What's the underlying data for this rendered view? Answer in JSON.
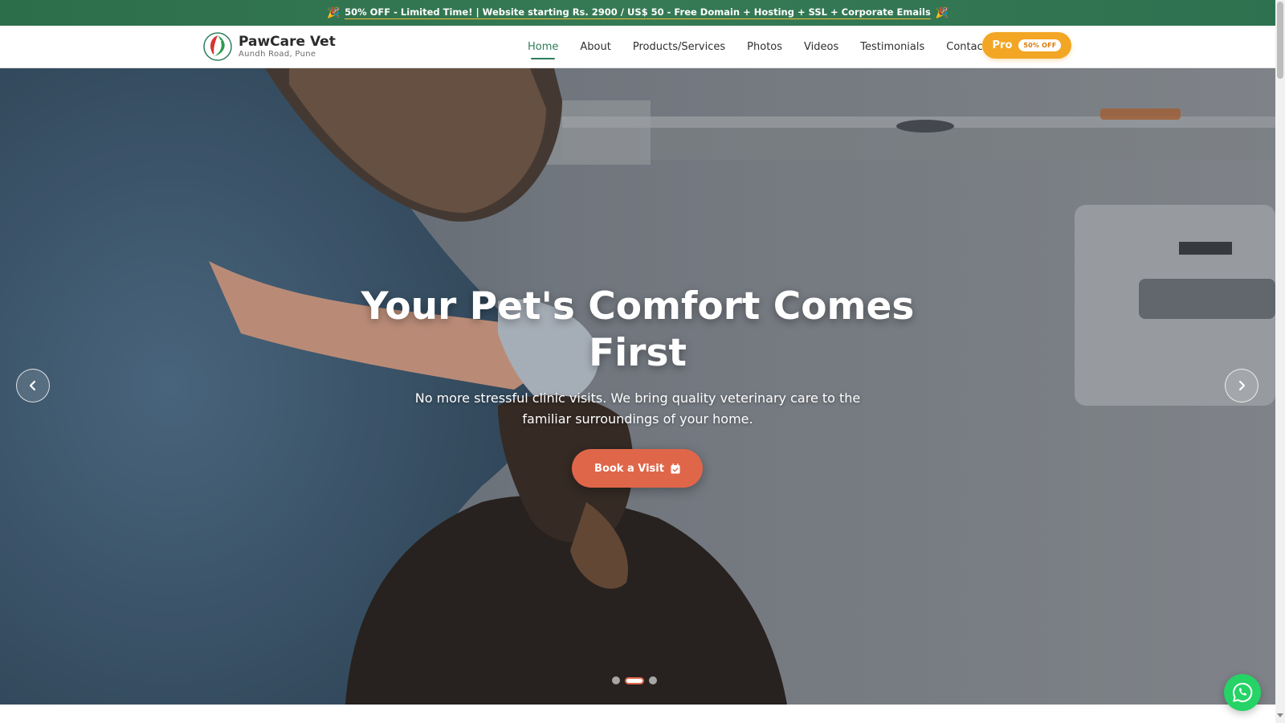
{
  "promo": {
    "text": "50% OFF - Limited Time! | Website starting Rs. 2900 / US$ 50 - Free Domain + Hosting + SSL + Corporate Emails",
    "icon_left": "🎉",
    "icon_right": "🎉"
  },
  "brand": {
    "name": "PawCare Vet",
    "location": "Aundh Road, Pune",
    "logo_icon": "leaf-logo-icon"
  },
  "nav": {
    "items": [
      {
        "label": "Home",
        "active": true
      },
      {
        "label": "About"
      },
      {
        "label": "Products/Services"
      },
      {
        "label": "Photos"
      },
      {
        "label": "Videos"
      },
      {
        "label": "Testimonials"
      },
      {
        "label": "Contact"
      }
    ],
    "pro_label": "Pro",
    "pro_badge": "50% OFF"
  },
  "hero": {
    "title": "Your Pet's Comfort Comes First",
    "subtitle": "No more stressful clinic visits. We bring quality veterinary care to the familiar surroundings of your home.",
    "cta_label": "Book a Visit",
    "cta_icon": "calendar-check-icon",
    "slides_count": 3,
    "active_slide": 2
  },
  "colors": {
    "promo_bg": "#2d6e4a",
    "brand_green": "#2e7d5a",
    "pro_orange": "#f2a623",
    "cta_coral": "#e0664a",
    "whatsapp": "#25d366"
  }
}
